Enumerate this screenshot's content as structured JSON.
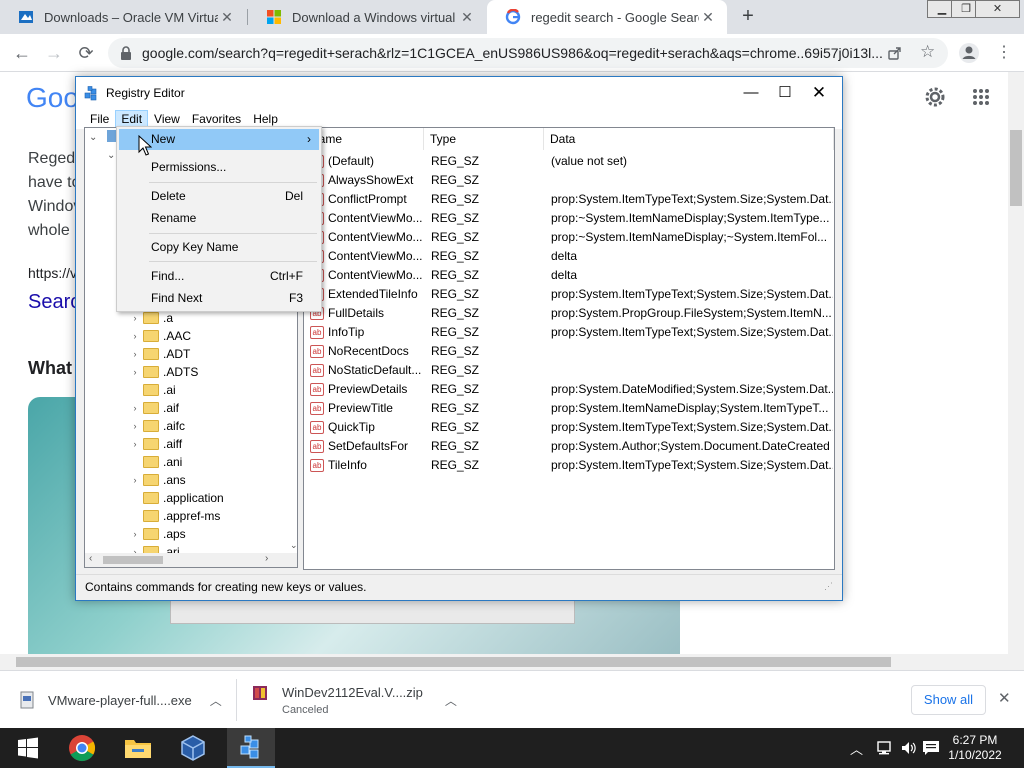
{
  "browser": {
    "tabs": [
      {
        "title": "Downloads – Oracle VM VirtualB",
        "icon": "virtualbox-icon"
      },
      {
        "title": "Download a Windows virtual ma",
        "icon": "windows-logo-icon"
      },
      {
        "title": "regedit search - Google Search",
        "icon": "google-g-icon",
        "active": true
      }
    ],
    "new_tab_label": "+",
    "url": "google.com/search?q=regedit+serach&rlz=1C1GCEA_enUS986US986&oq=regedit+serach&aqs=chrome..69i57j0i13l..."
  },
  "page": {
    "logo_partial": "Goo",
    "line1": "Reged",
    "line2": "have to",
    "line3": "Windov",
    "line4": "whole",
    "link_partial": "https://v",
    "search_partial": "Searc",
    "heading_partial": "What"
  },
  "registry": {
    "title": "Registry Editor",
    "menu": [
      "File",
      "Edit",
      "View",
      "Favorites",
      "Help"
    ],
    "columns": [
      "Name",
      "Type",
      "Data"
    ],
    "tree": [
      ".a",
      ".AAC",
      ".ADT",
      ".ADTS",
      ".ai",
      ".aif",
      ".aifc",
      ".aiff",
      ".ani",
      ".ans",
      ".application",
      ".appref-ms",
      ".aps",
      ".ari"
    ],
    "rows": [
      {
        "name": "(Default)",
        "type": "REG_SZ",
        "data": "(value not set)"
      },
      {
        "name": "AlwaysShowExt",
        "type": "REG_SZ",
        "data": ""
      },
      {
        "name": "ConflictPrompt",
        "type": "REG_SZ",
        "data": "prop:System.ItemTypeText;System.Size;System.Dat..."
      },
      {
        "name": "ContentViewMo...",
        "type": "REG_SZ",
        "data": "prop:~System.ItemNameDisplay;System.ItemType..."
      },
      {
        "name": "ContentViewMo...",
        "type": "REG_SZ",
        "data": "prop:~System.ItemNameDisplay;~System.ItemFol..."
      },
      {
        "name": "ContentViewMo...",
        "type": "REG_SZ",
        "data": "delta"
      },
      {
        "name": "ContentViewMo...",
        "type": "REG_SZ",
        "data": "delta"
      },
      {
        "name": "ExtendedTileInfo",
        "type": "REG_SZ",
        "data": "prop:System.ItemTypeText;System.Size;System.Dat..."
      },
      {
        "name": "FullDetails",
        "type": "REG_SZ",
        "data": "prop:System.PropGroup.FileSystem;System.ItemN..."
      },
      {
        "name": "InfoTip",
        "type": "REG_SZ",
        "data": "prop:System.ItemTypeText;System.Size;System.Dat..."
      },
      {
        "name": "NoRecentDocs",
        "type": "REG_SZ",
        "data": ""
      },
      {
        "name": "NoStaticDefault...",
        "type": "REG_SZ",
        "data": ""
      },
      {
        "name": "PreviewDetails",
        "type": "REG_SZ",
        "data": "prop:System.DateModified;System.Size;System.Dat..."
      },
      {
        "name": "PreviewTitle",
        "type": "REG_SZ",
        "data": "prop:System.ItemNameDisplay;System.ItemTypeT..."
      },
      {
        "name": "QuickTip",
        "type": "REG_SZ",
        "data": "prop:System.ItemTypeText;System.Size;System.Dat..."
      },
      {
        "name": "SetDefaultsFor",
        "type": "REG_SZ",
        "data": "prop:System.Author;System.Document.DateCreated"
      },
      {
        "name": "TileInfo",
        "type": "REG_SZ",
        "data": "prop:System.ItemTypeText;System.Size;System.Dat..."
      }
    ],
    "status": "Contains commands for creating new keys or values."
  },
  "edit_menu": {
    "new": "New",
    "permissions": "Permissions...",
    "delete": "Delete",
    "delete_shortcut": "Del",
    "rename": "Rename",
    "copy_key_name": "Copy Key Name",
    "find": "Find...",
    "find_shortcut": "Ctrl+F",
    "find_next": "Find Next",
    "find_next_shortcut": "F3"
  },
  "downloads": {
    "item1": "VMware-player-full....exe",
    "item2": "WinDev2112Eval.V....zip",
    "item2_status": "Canceled",
    "show_all": "Show all"
  },
  "taskbar": {
    "time": "6:27 PM",
    "date": "1/10/2022"
  },
  "colors": {
    "google_blue": "#4285f4",
    "link_blue": "#1a0dab",
    "menu_highlight": "#91c9f7",
    "titlebar_border": "#2b79c2"
  }
}
